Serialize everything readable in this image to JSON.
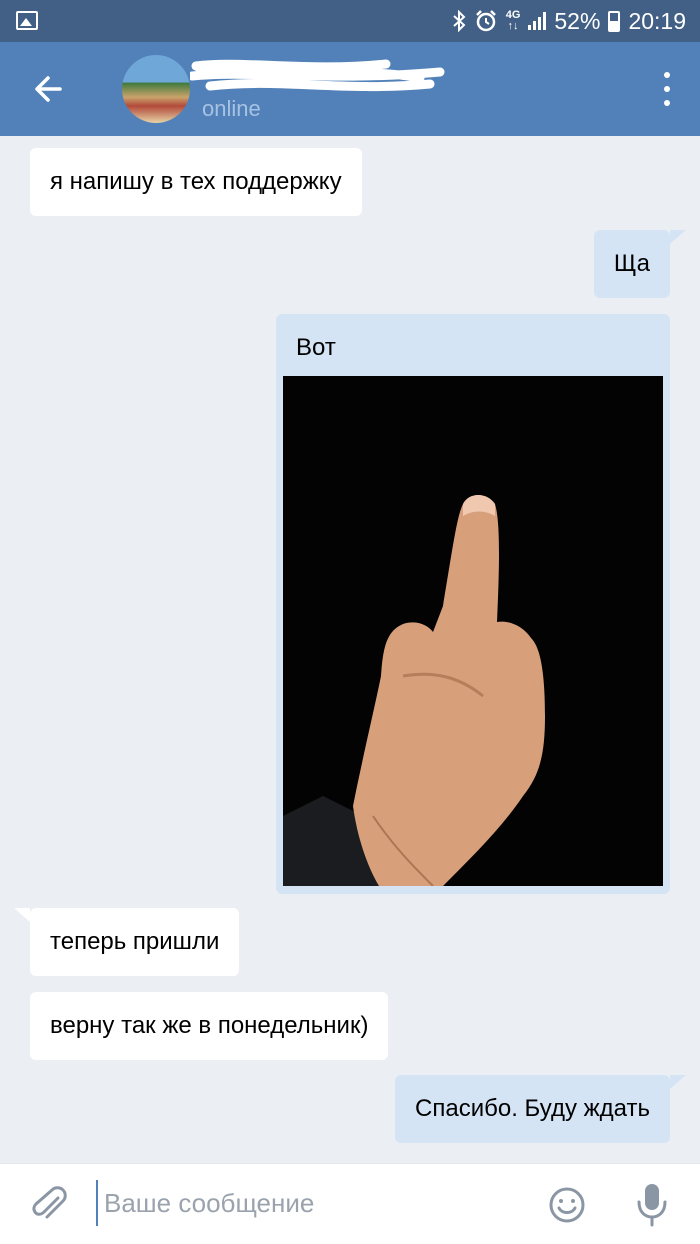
{
  "status_bar": {
    "network": "4G",
    "battery": "52%",
    "time": "20:19",
    "icons": [
      "gallery-icon",
      "bluetooth-icon",
      "alarm-icon",
      "network-4g-icon",
      "signal-icon",
      "battery-icon"
    ]
  },
  "header": {
    "contact_status": "online",
    "icons": [
      "back-arrow-icon",
      "avatar",
      "more-vertical-icon"
    ],
    "colors": {
      "status_bar": "#425f85",
      "header": "#5181b8"
    }
  },
  "messages": [
    {
      "direction": "in",
      "text": "я напишу в тех поддержку"
    },
    {
      "direction": "out",
      "text": "Ща"
    },
    {
      "direction": "out",
      "text": "Вот",
      "attachment": "photo"
    },
    {
      "direction": "in",
      "text": "теперь пришли"
    },
    {
      "direction": "in",
      "text": "верну так же в понедельник)"
    },
    {
      "direction": "out",
      "text": "Спасибо. Буду ждать"
    }
  ],
  "composer": {
    "placeholder": "Ваше сообщение",
    "icons": [
      "paperclip-icon",
      "emoji-icon",
      "microphone-icon"
    ]
  },
  "colors": {
    "background": "#ebeff3",
    "incoming_bubble": "#ffffff",
    "outgoing_bubble": "#d5e4f5"
  }
}
